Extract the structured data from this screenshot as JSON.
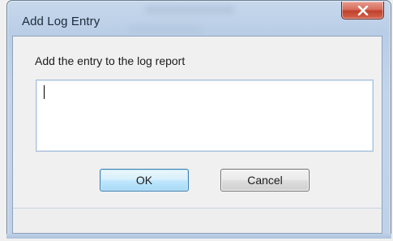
{
  "window": {
    "title": "Add Log Entry",
    "close_icon": "close-icon"
  },
  "dialog": {
    "prompt": "Add the entry to the log report",
    "entry_value": "",
    "ok_label": "OK",
    "cancel_label": "Cancel"
  },
  "colors": {
    "close_button": "#c0412d",
    "ok_border": "#3c7fb1",
    "frame": "#bfd2e9"
  }
}
